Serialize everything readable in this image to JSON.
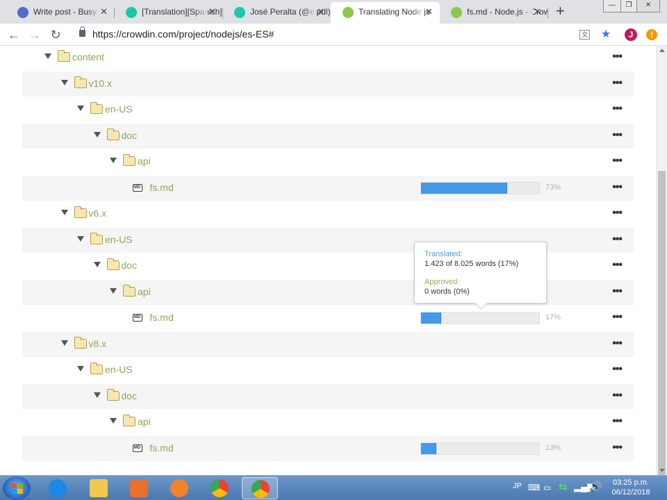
{
  "browser": {
    "tabs": [
      {
        "title": "Write post - Busy",
        "active": false,
        "favicon_color": "#5468ce"
      },
      {
        "title": "[Translation][Spanish]",
        "active": false,
        "favicon_color": "#1dc7a9"
      },
      {
        "title": "José Peralta (@elpdl)",
        "active": false,
        "favicon_color": "#1dc7a9"
      },
      {
        "title": "Translating Node.js",
        "active": true,
        "favicon_color": "#8cc84b"
      },
      {
        "title": "fs.md - Node.js - Crowdin",
        "active": false,
        "favicon_color": "#8cc84b"
      }
    ],
    "tab_close_glyph": "✕",
    "new_tab_glyph": "+",
    "window_controls": [
      "—",
      "❐",
      "✕"
    ],
    "url": "https://crowdin.com/project/nodejs/es-ES#",
    "profile_initial": "J",
    "alert_glyph": "!"
  },
  "tree": [
    {
      "name": "content",
      "type": "folder",
      "level": 0,
      "progress": null,
      "percent_label": ""
    },
    {
      "name": "v10.x",
      "type": "folder",
      "level": 1,
      "progress": null,
      "percent_label": ""
    },
    {
      "name": "en-US",
      "type": "folder",
      "level": 2,
      "progress": null,
      "percent_label": ""
    },
    {
      "name": "doc",
      "type": "folder",
      "level": 3,
      "progress": null,
      "percent_label": ""
    },
    {
      "name": "api",
      "type": "folder",
      "level": 4,
      "progress": null,
      "percent_label": ""
    },
    {
      "name": "fs.md",
      "type": "file",
      "level": 5,
      "progress": 0.73,
      "percent_label": "73%"
    },
    {
      "name": "v6.x",
      "type": "folder",
      "level": 1,
      "progress": null,
      "percent_label": ""
    },
    {
      "name": "en-US",
      "type": "folder",
      "level": 2,
      "progress": null,
      "percent_label": ""
    },
    {
      "name": "doc",
      "type": "folder",
      "level": 3,
      "progress": null,
      "percent_label": ""
    },
    {
      "name": "api",
      "type": "folder",
      "level": 4,
      "progress": null,
      "percent_label": ""
    },
    {
      "name": "fs.md",
      "type": "file",
      "level": 5,
      "progress": 0.17,
      "percent_label": "17%"
    },
    {
      "name": "v8.x",
      "type": "folder",
      "level": 1,
      "progress": null,
      "percent_label": ""
    },
    {
      "name": "en-US",
      "type": "folder",
      "level": 2,
      "progress": null,
      "percent_label": ""
    },
    {
      "name": "doc",
      "type": "folder",
      "level": 3,
      "progress": null,
      "percent_label": ""
    },
    {
      "name": "api",
      "type": "folder",
      "level": 4,
      "progress": null,
      "percent_label": ""
    },
    {
      "name": "fs.md",
      "type": "file",
      "level": 5,
      "progress": 0.13,
      "percent_label": "13%"
    }
  ],
  "more_glyph": "•••",
  "file_icon_text": "MD",
  "tooltip": {
    "translated_label": "Translated:",
    "translated_value": "1.423 of 8.025 words (17%)",
    "approved_label": "Approved:",
    "approved_value": "0 words (0%)"
  },
  "taskbar": {
    "apps": [
      {
        "name": "internet-explorer",
        "color": "#1e88e5",
        "active": false
      },
      {
        "name": "file-explorer",
        "color": "#f2c94c",
        "active": false
      },
      {
        "name": "media-player",
        "color": "#e8702a",
        "active": false
      },
      {
        "name": "firefox",
        "color": "#f4822b",
        "active": false
      },
      {
        "name": "chrome",
        "color": "#34a853",
        "active": false
      },
      {
        "name": "chrome-active",
        "color": "#34a853",
        "active": true
      }
    ],
    "language": "JP",
    "time": "03:25 p.m.",
    "date": "06/12/2018"
  },
  "colors": {
    "progress_fill": "#439ae8",
    "folder_text": "#8aa85a",
    "translated_label": "#4a9be0",
    "approved_label": "#8ab15a"
  }
}
